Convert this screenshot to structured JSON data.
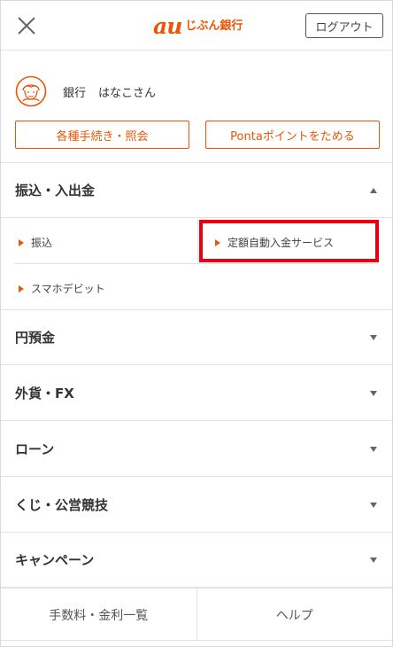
{
  "header": {
    "logo_au": "au",
    "logo_text": "じぶん銀行",
    "logout_label": "ログアウト"
  },
  "user": {
    "label": "銀行",
    "name": "はなこさん"
  },
  "actions": {
    "procedures_label": "各種手続き・照会",
    "ponta_label": "Pontaポイントをためる"
  },
  "menu": {
    "transfer": {
      "title": "振込・入出金",
      "expanded": true,
      "items": [
        {
          "label": "振込"
        },
        {
          "label": "定額自動入金サービス"
        },
        {
          "label": "スマホデビット"
        }
      ]
    },
    "sections": [
      {
        "title": "円預金"
      },
      {
        "title": "外貨・FX"
      },
      {
        "title": "ローン"
      },
      {
        "title": "くじ・公営競技"
      },
      {
        "title": "キャンペーン"
      }
    ]
  },
  "footer": {
    "fees_label": "手数料・金利一覧",
    "help_label": "ヘルプ"
  },
  "colors": {
    "accent": "#eb5505",
    "highlight": "#e60012",
    "arrow": "#666666"
  }
}
